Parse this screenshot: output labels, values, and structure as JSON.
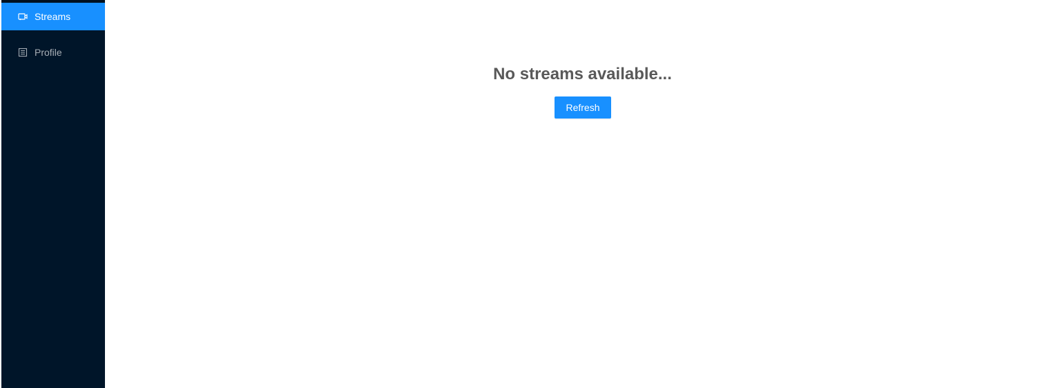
{
  "sidebar": {
    "items": [
      {
        "label": "Streams",
        "icon": "video-camera-icon",
        "active": true
      },
      {
        "label": "Profile",
        "icon": "profile-icon",
        "active": false
      }
    ]
  },
  "main": {
    "empty_message": "No streams available...",
    "refresh_label": "Refresh"
  },
  "colors": {
    "sidebar_bg": "#001529",
    "accent": "#1890ff",
    "title_text": "#595959"
  }
}
